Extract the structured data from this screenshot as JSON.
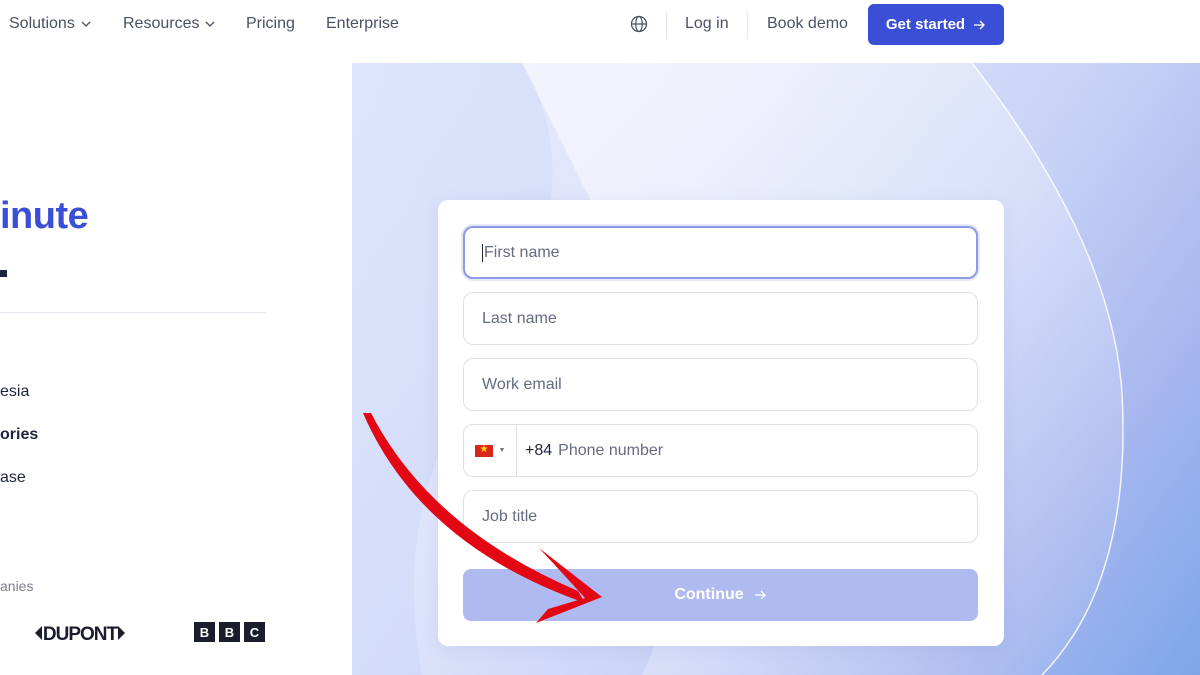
{
  "nav": {
    "solutions": "Solutions",
    "resources": "Resources",
    "pricing": "Pricing",
    "enterprise": "Enterprise",
    "login": "Log in",
    "book_demo": "Book demo",
    "get_started": "Get started",
    "globe_icon": "globe-icon"
  },
  "hero": {
    "title_fragment": "inute"
  },
  "features": [
    "esia",
    "ories",
    "ase"
  ],
  "companies_label": "anies",
  "logos": [
    "DUPONT",
    "B",
    "B",
    "C"
  ],
  "form": {
    "first_name_placeholder": "First name",
    "last_name_placeholder": "Last name",
    "work_email_placeholder": "Work email",
    "dial_code": "+84",
    "phone_placeholder": "Phone number",
    "job_title_placeholder": "Job title",
    "continue_label": "Continue"
  },
  "colors": {
    "accent": "#3b4fd6",
    "continue_disabled": "#afbaf0",
    "annotation_arrow": "#e30613"
  }
}
